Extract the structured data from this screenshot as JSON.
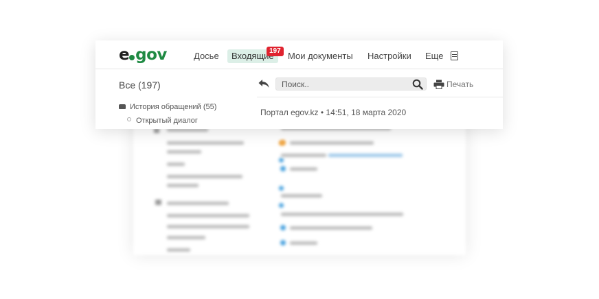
{
  "brand": {
    "logo_e": "e",
    "logo_gov": "gov"
  },
  "nav": {
    "dossier": "Досье",
    "inbox": "Входящие",
    "inbox_badge": "197",
    "documents": "Мои документы",
    "settings": "Настройки",
    "more": "Еще",
    "more_icon": "document-icon"
  },
  "sidebar": {
    "all_label": "Все (197)",
    "items": [
      {
        "label": "История обращений (55)",
        "icon": "inbox-icon"
      },
      {
        "label": "Открытый диалог"
      }
    ]
  },
  "toolbar": {
    "reply_icon": "reply-icon",
    "search_placeholder": "Поиск..",
    "search_icon": "search-icon",
    "print_icon": "printer-icon",
    "print_label": "Печать"
  },
  "message": {
    "meta": "Портал egov.kz • 14:51, 18 марта 2020"
  },
  "colors": {
    "brand_green": "#1f8a43",
    "badge_red": "#e0232f",
    "active_tab_bg": "#dcefe7",
    "link_blue": "#4aa3df"
  }
}
